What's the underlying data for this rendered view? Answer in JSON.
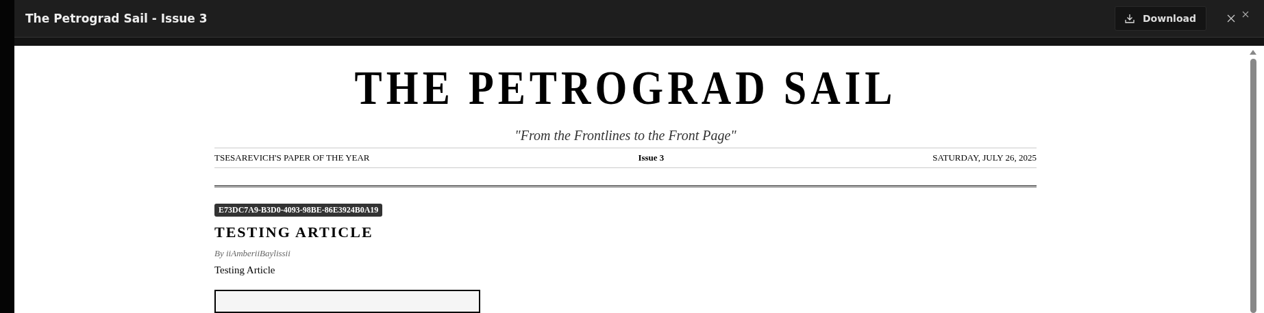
{
  "window": {
    "title": "The Petrograd Sail - Issue 3"
  },
  "download_button": {
    "label": "Download"
  },
  "paper": {
    "masthead": "THE PETROGRAD SAIL",
    "tagline": "\"From the Frontlines to the Front Page\"",
    "info": [
      "TSESAREVICH'S PAPER OF THE YEAR",
      "Issue 3",
      "SATURDAY, JULY 26, 2025"
    ]
  },
  "article": {
    "id_badge": "E73DC7A9-B3D0-4093-98BE-86E3924B0A19",
    "title": "TESTING ARTICLE",
    "byline": "By iiAmberiiBaylissii",
    "body": "Testing Article"
  }
}
